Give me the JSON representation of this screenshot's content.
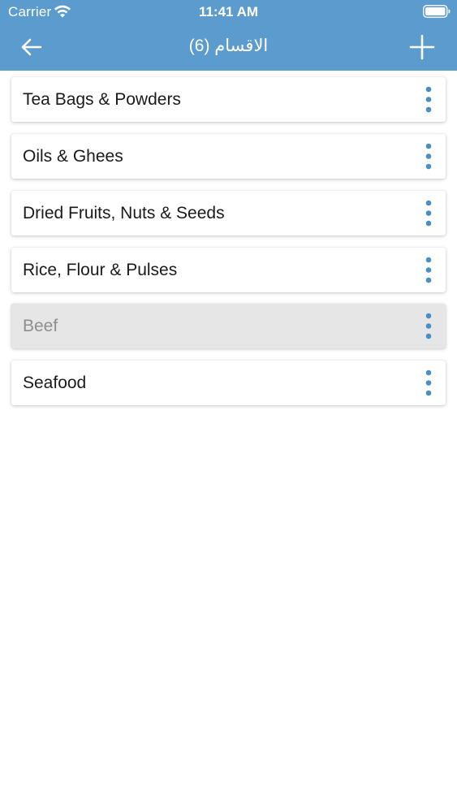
{
  "status_bar": {
    "carrier": "Carrier",
    "time": "11:41 AM"
  },
  "header": {
    "title": "الاقسام (6)",
    "back_icon": "arrow-left-icon",
    "add_icon": "plus-icon"
  },
  "categories": [
    {
      "label": "Tea Bags & Powders",
      "disabled": false
    },
    {
      "label": "Oils & Ghees",
      "disabled": false
    },
    {
      "label": "Dried Fruits, Nuts & Seeds",
      "disabled": false
    },
    {
      "label": "Rice, Flour & Pulses",
      "disabled": false
    },
    {
      "label": "Beef",
      "disabled": true
    },
    {
      "label": "Seafood",
      "disabled": false
    }
  ],
  "colors": {
    "header_bg": "#5b9bcd",
    "accent": "#4a8fc4",
    "disabled_bg": "#e6e6e6",
    "disabled_text": "#8e8e8e"
  }
}
